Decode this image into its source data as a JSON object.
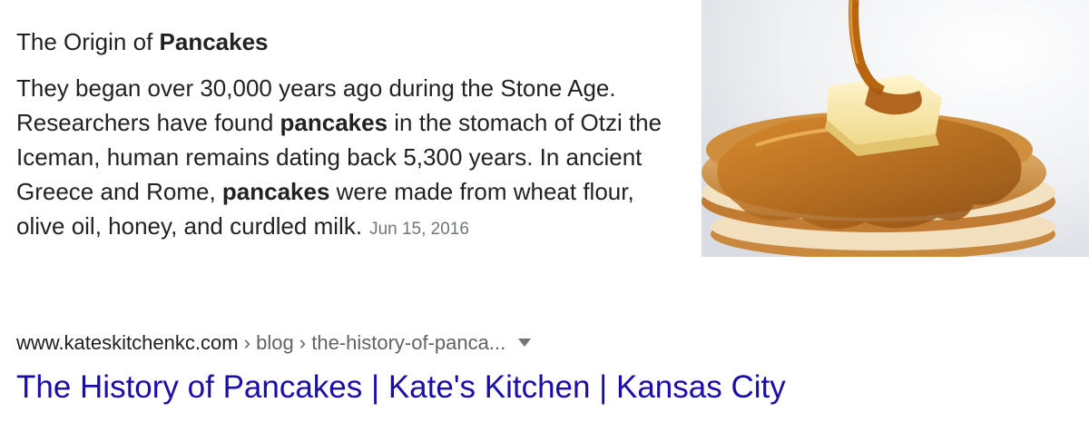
{
  "snippet": {
    "heading_prefix": "The Origin of ",
    "heading_bold": "Pancakes",
    "text": {
      "part1": "They began over 30,000 years ago during the Stone Age. Researchers have found ",
      "bold1": "pancakes",
      "part2": " in the stomach of Otzi the Iceman, human remains dating back 5,300 years. In ancient Greece and Rome, ",
      "bold2": "pancakes",
      "part3": " were made from wheat flour, olive oil, honey, and curdled milk."
    },
    "date": "Jun 15, 2016"
  },
  "image": {
    "subject": "pancake-stack-with-syrup-and-butter"
  },
  "result": {
    "domain": "www.kateskitchenkc.com",
    "breadcrumb": " › blog › the-history-of-panca...",
    "title": "The History of Pancakes | Kate's Kitchen | Kansas City"
  },
  "colors": {
    "link": "#1a0dab",
    "text": "#222222",
    "muted": "#70757a"
  }
}
